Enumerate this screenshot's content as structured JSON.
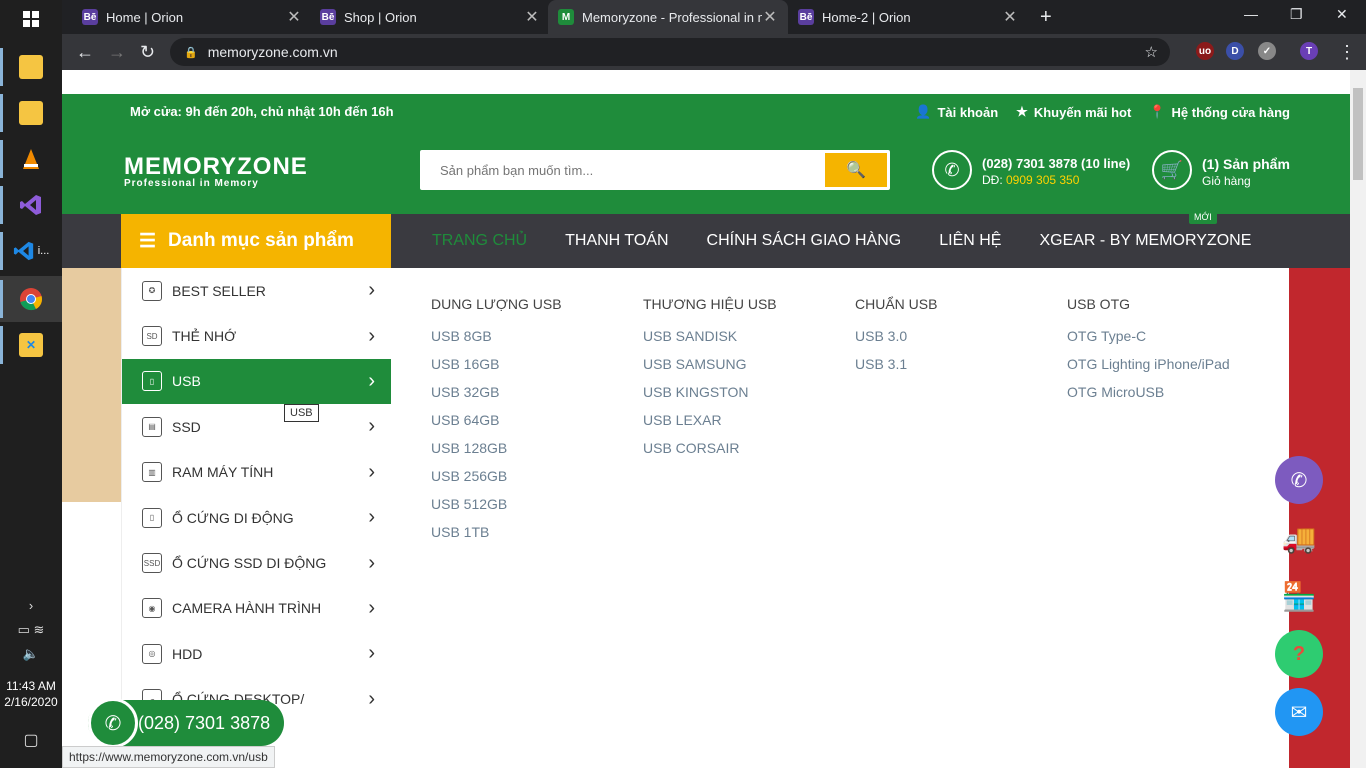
{
  "taskbar": {
    "clock_time": "11:43 AM",
    "clock_date": "2/16/2020",
    "apps": [
      {
        "name": "file-explorer",
        "label": "",
        "color": "#f5c542"
      },
      {
        "name": "file-explorer-2",
        "label": "",
        "color": "#f5c542"
      },
      {
        "name": "vlc",
        "label": "",
        "color": "#f08a00"
      },
      {
        "name": "visual-studio",
        "label": "",
        "color": "#7a3fc8"
      },
      {
        "name": "vscode",
        "label": "i...",
        "color": "#1e88e5"
      },
      {
        "name": "chrome",
        "label": "",
        "color": "#34a853"
      },
      {
        "name": "tool",
        "label": "",
        "color": "#f5c542"
      }
    ]
  },
  "browser": {
    "tabs": [
      {
        "title": "Home | Orion",
        "fav": "Bē",
        "color": "#5a3e9e"
      },
      {
        "title": "Shop | Orion",
        "fav": "Bē",
        "color": "#5a3e9e"
      },
      {
        "title": "Memoryzone - Professional in me",
        "fav": "M",
        "color": "#1f8c3b"
      },
      {
        "title": "Home-2 | Orion",
        "fav": "Bē",
        "color": "#5a3e9e"
      }
    ],
    "url": "memoryzone.com.vn",
    "status_url": "https://www.memoryzone.com.vn/usb"
  },
  "topbar": {
    "hours": "Mở cửa: 9h đến 20h, chủ nhật 10h đến 16h",
    "account": "Tài khoản",
    "promo": "Khuyến mãi hot",
    "stores": "Hệ thống cửa hàng"
  },
  "header": {
    "logo_main": "MEMORYZONE",
    "logo_sub": "Professional in Memory",
    "search_placeholder": "Sản phẩm bạn muốn tìm...",
    "hotline_label": "(028) 7301 3878 (10 line)",
    "hotline_dd_prefix": "DĐ: ",
    "hotline_dd": "0909 305 350",
    "cart_count": "(1) Sản phẩm",
    "cart_label": "Giỏ hàng"
  },
  "nav": {
    "category_button": "Danh mục sản phẩm",
    "items": [
      "TRANG CHỦ",
      "THANH TOÁN",
      "CHÍNH SÁCH GIAO HÀNG",
      "LIÊN HỆ",
      "XGEAR - BY MEMORYZONE"
    ],
    "new_badge": "MỚI"
  },
  "categories": [
    {
      "label": "BEST SELLER",
      "icon": "medal"
    },
    {
      "label": "THẺ NHỚ",
      "icon": "sd"
    },
    {
      "label": "USB",
      "icon": "usb"
    },
    {
      "label": "SSD",
      "icon": "ssd"
    },
    {
      "label": "RAM MÁY TÍNH",
      "icon": "ram"
    },
    {
      "label": "Ổ CỨNG DI ĐỘNG",
      "icon": "hdd"
    },
    {
      "label": "Ổ CỨNG SSD DI ĐỘNG",
      "icon": "ssd"
    },
    {
      "label": "CAMERA HÀNH TRÌNH",
      "icon": "cam"
    },
    {
      "label": "HDD",
      "icon": "hdd"
    },
    {
      "label": "Ổ CỨNG DESKTOP/",
      "icon": "cloud"
    }
  ],
  "tooltip": "USB",
  "mega": {
    "columns": [
      {
        "title": "DUNG LƯỢNG USB",
        "links": [
          "USB 8GB",
          "USB 16GB",
          "USB 32GB",
          "USB 64GB",
          "USB 128GB",
          "USB 256GB",
          "USB 512GB",
          "USB 1TB"
        ]
      },
      {
        "title": "THƯƠNG HIỆU USB",
        "links": [
          "USB SANDISK",
          "USB SAMSUNG",
          "USB KINGSTON",
          "USB LEXAR",
          "USB CORSAIR"
        ]
      },
      {
        "title": "CHUẨN USB",
        "links": [
          "USB 3.0",
          "USB 3.1"
        ]
      },
      {
        "title": "USB OTG",
        "links": [
          "OTG Type-C",
          "OTG Lighting iPhone/iPad",
          "OTG MicroUSB"
        ]
      }
    ]
  },
  "phone_pill": "(028) 7301 3878"
}
